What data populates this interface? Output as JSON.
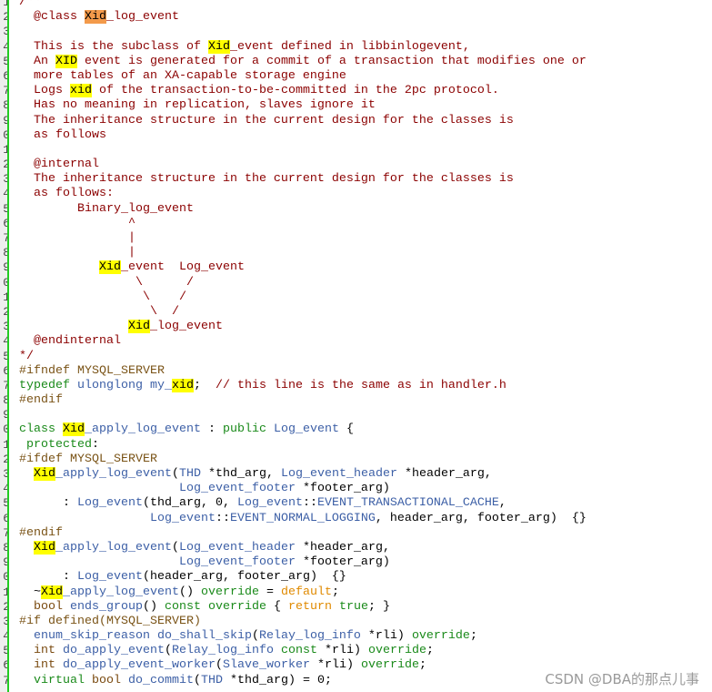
{
  "editor": {
    "colors": {
      "comment": "#8b0000",
      "preprocessor": "#7a5316",
      "keyword": "#1a8a1a",
      "identifier": "#3c5fa6",
      "literal": "#e08a00",
      "highlight": "#ffff00",
      "current_match": "#f39a4a",
      "gutter_bar": "#22cc22"
    },
    "lines": [
      {
        "g": "1",
        "t": [
          [
            "/**",
            "c"
          ]
        ]
      },
      {
        "g": "2",
        "t": [
          [
            "  @class ",
            "c"
          ],
          [
            "Xid",
            "ho"
          ],
          [
            "_log_event",
            "c"
          ]
        ]
      },
      {
        "g": "3",
        "t": []
      },
      {
        "g": "4",
        "t": [
          [
            "  This is the subclass of ",
            "c"
          ],
          [
            "Xid",
            "hl"
          ],
          [
            "_event defined in libbinlogevent,",
            "c"
          ]
        ]
      },
      {
        "g": "5",
        "t": [
          [
            "  An ",
            "c"
          ],
          [
            "XID",
            "hl"
          ],
          [
            " event is generated for a commit of a transaction that modifies one or",
            "c"
          ]
        ]
      },
      {
        "g": "6",
        "t": [
          [
            "  more tables of an XA-capable storage engine",
            "c"
          ]
        ]
      },
      {
        "g": "7",
        "t": [
          [
            "  Logs ",
            "c"
          ],
          [
            "xid",
            "hl"
          ],
          [
            " of the transaction-to-be-committed in the 2pc protocol.",
            "c"
          ]
        ]
      },
      {
        "g": "8",
        "t": [
          [
            "  Has no meaning in replication, slaves ignore it",
            "c"
          ]
        ]
      },
      {
        "g": "9",
        "t": [
          [
            "  The inheritance structure in the current design for the classes is",
            "c"
          ]
        ]
      },
      {
        "g": "0",
        "t": [
          [
            "  as follows",
            "c"
          ]
        ]
      },
      {
        "g": "1",
        "t": []
      },
      {
        "g": "2",
        "t": [
          [
            "  @internal",
            "c"
          ]
        ]
      },
      {
        "g": "3",
        "t": [
          [
            "  The inheritance structure in the current design for the classes is",
            "c"
          ]
        ]
      },
      {
        "g": "4",
        "t": [
          [
            "  as follows:",
            "c"
          ]
        ]
      },
      {
        "g": "5",
        "t": [
          [
            "        Binary_log_event",
            "c"
          ]
        ]
      },
      {
        "g": "6",
        "t": [
          [
            "               ^",
            "c"
          ]
        ]
      },
      {
        "g": "7",
        "t": [
          [
            "               |",
            "c"
          ]
        ]
      },
      {
        "g": "8",
        "t": [
          [
            "               |",
            "c"
          ]
        ]
      },
      {
        "g": "9",
        "t": [
          [
            "           ",
            "c"
          ],
          [
            "Xid",
            "hl"
          ],
          [
            "_event  Log_event",
            "c"
          ]
        ]
      },
      {
        "g": "0",
        "t": [
          [
            "                \\      /",
            "c"
          ]
        ]
      },
      {
        "g": "1",
        "t": [
          [
            "                 \\    /",
            "c"
          ]
        ]
      },
      {
        "g": "2",
        "t": [
          [
            "                  \\  /",
            "c"
          ]
        ]
      },
      {
        "g": "3",
        "t": [
          [
            "               ",
            "c"
          ],
          [
            "Xid",
            "hl"
          ],
          [
            "_log_event",
            "c"
          ]
        ]
      },
      {
        "g": "4",
        "t": [
          [
            "  @endinternal",
            "c"
          ]
        ]
      },
      {
        "g": "5",
        "t": [
          [
            "*/",
            "c"
          ]
        ]
      },
      {
        "g": "6",
        "t": [
          [
            "#ifndef MYSQL_SERVER",
            "p"
          ]
        ]
      },
      {
        "g": "7",
        "t": [
          [
            "typedef",
            "k"
          ],
          [
            " ",
            "n"
          ],
          [
            "ulonglong my_",
            "t"
          ],
          [
            "xid",
            "hl"
          ],
          [
            ";  ",
            "n"
          ],
          [
            "// this line is the same as in handler.h",
            "c"
          ]
        ]
      },
      {
        "g": "8",
        "t": [
          [
            "#endif",
            "p"
          ]
        ]
      },
      {
        "g": "9",
        "t": []
      },
      {
        "g": "0",
        "t": [
          [
            "class",
            "k"
          ],
          [
            " ",
            "n"
          ],
          [
            "Xid",
            "hl"
          ],
          [
            "_apply_log_event",
            "t"
          ],
          [
            " : ",
            "n"
          ],
          [
            "public",
            "k"
          ],
          [
            " ",
            "n"
          ],
          [
            "Log_event",
            "t"
          ],
          [
            " {",
            "n"
          ]
        ]
      },
      {
        "g": "1",
        "t": [
          [
            " protected",
            "k"
          ],
          [
            ":",
            "n"
          ]
        ]
      },
      {
        "g": "2",
        "t": [
          [
            "#ifdef MYSQL_SERVER",
            "p"
          ]
        ]
      },
      {
        "g": "3",
        "t": [
          [
            "  ",
            "n"
          ],
          [
            "Xid",
            "hl"
          ],
          [
            "_apply_log_event",
            "t"
          ],
          [
            "(",
            "n"
          ],
          [
            "THD",
            "t"
          ],
          [
            " *thd_arg, ",
            "n"
          ],
          [
            "Log_event_header",
            "t"
          ],
          [
            " *header_arg,",
            "n"
          ]
        ]
      },
      {
        "g": "4",
        "t": [
          [
            "                      ",
            "n"
          ],
          [
            "Log_event_footer",
            "t"
          ],
          [
            " *footer_arg)",
            "n"
          ]
        ]
      },
      {
        "g": "5",
        "t": [
          [
            "      : ",
            "n"
          ],
          [
            "Log_event",
            "t"
          ],
          [
            "(thd_arg, 0, ",
            "n"
          ],
          [
            "Log_event",
            "t"
          ],
          [
            "::",
            "n"
          ],
          [
            "EVENT_TRANSACTIONAL_CACHE",
            "t"
          ],
          [
            ",",
            "n"
          ]
        ]
      },
      {
        "g": "6",
        "t": [
          [
            "                  ",
            "n"
          ],
          [
            "Log_event",
            "t"
          ],
          [
            "::",
            "n"
          ],
          [
            "EVENT_NORMAL_LOGGING",
            "t"
          ],
          [
            ", header_arg, footer_arg)  {}",
            "n"
          ]
        ]
      },
      {
        "g": "7",
        "t": [
          [
            "#endif",
            "p"
          ]
        ]
      },
      {
        "g": "8",
        "t": [
          [
            "  ",
            "n"
          ],
          [
            "Xid",
            "hl"
          ],
          [
            "_apply_log_event",
            "t"
          ],
          [
            "(",
            "n"
          ],
          [
            "Log_event_header",
            "t"
          ],
          [
            " *header_arg,",
            "n"
          ]
        ]
      },
      {
        "g": "9",
        "t": [
          [
            "                      ",
            "n"
          ],
          [
            "Log_event_footer",
            "t"
          ],
          [
            " *footer_arg)",
            "n"
          ]
        ]
      },
      {
        "g": "0",
        "t": [
          [
            "      : ",
            "n"
          ],
          [
            "Log_event",
            "t"
          ],
          [
            "(header_arg, footer_arg)  {}",
            "n"
          ]
        ]
      },
      {
        "g": "1",
        "t": [
          [
            "  ~",
            "n"
          ],
          [
            "Xid",
            "hl"
          ],
          [
            "_apply_log_event",
            "t"
          ],
          [
            "() ",
            "n"
          ],
          [
            "override",
            "k"
          ],
          [
            " = ",
            "n"
          ],
          [
            "default",
            "o"
          ],
          [
            ";",
            "n"
          ]
        ]
      },
      {
        "g": "2",
        "t": [
          [
            "  ",
            "n"
          ],
          [
            "bool",
            "b"
          ],
          [
            " ",
            "n"
          ],
          [
            "ends_group",
            "t"
          ],
          [
            "() ",
            "n"
          ],
          [
            "const",
            "k"
          ],
          [
            " ",
            "n"
          ],
          [
            "override",
            "k"
          ],
          [
            " { ",
            "n"
          ],
          [
            "return",
            "o"
          ],
          [
            " ",
            "n"
          ],
          [
            "true",
            "k"
          ],
          [
            "; }",
            "n"
          ]
        ]
      },
      {
        "g": "3",
        "t": [
          [
            "#if defined(MYSQL_SERVER)",
            "p"
          ]
        ]
      },
      {
        "g": "4",
        "t": [
          [
            "  ",
            "n"
          ],
          [
            "enum_skip_reason do_shall_skip",
            "t"
          ],
          [
            "(",
            "n"
          ],
          [
            "Relay_log_info",
            "t"
          ],
          [
            " *rli) ",
            "n"
          ],
          [
            "override",
            "k"
          ],
          [
            ";",
            "n"
          ]
        ]
      },
      {
        "g": "5",
        "t": [
          [
            "  ",
            "n"
          ],
          [
            "int",
            "b"
          ],
          [
            " ",
            "n"
          ],
          [
            "do_apply_event",
            "t"
          ],
          [
            "(",
            "n"
          ],
          [
            "Relay_log_info",
            "t"
          ],
          [
            " ",
            "n"
          ],
          [
            "const",
            "k"
          ],
          [
            " *rli) ",
            "n"
          ],
          [
            "override",
            "k"
          ],
          [
            ";",
            "n"
          ]
        ]
      },
      {
        "g": "6",
        "t": [
          [
            "  ",
            "n"
          ],
          [
            "int",
            "b"
          ],
          [
            " ",
            "n"
          ],
          [
            "do_apply_event_worker",
            "t"
          ],
          [
            "(",
            "n"
          ],
          [
            "Slave_worker",
            "t"
          ],
          [
            " *rli) ",
            "n"
          ],
          [
            "override",
            "k"
          ],
          [
            ";",
            "n"
          ]
        ]
      },
      {
        "g": "7",
        "t": [
          [
            "  ",
            "n"
          ],
          [
            "virtual",
            "k"
          ],
          [
            " ",
            "n"
          ],
          [
            "bool",
            "b"
          ],
          [
            " ",
            "n"
          ],
          [
            "do_commit",
            "t"
          ],
          [
            "(",
            "n"
          ],
          [
            "THD",
            "t"
          ],
          [
            " *thd_arg) = 0;",
            "n"
          ]
        ]
      }
    ]
  },
  "watermark": "CSDN @DBA的那点儿事"
}
